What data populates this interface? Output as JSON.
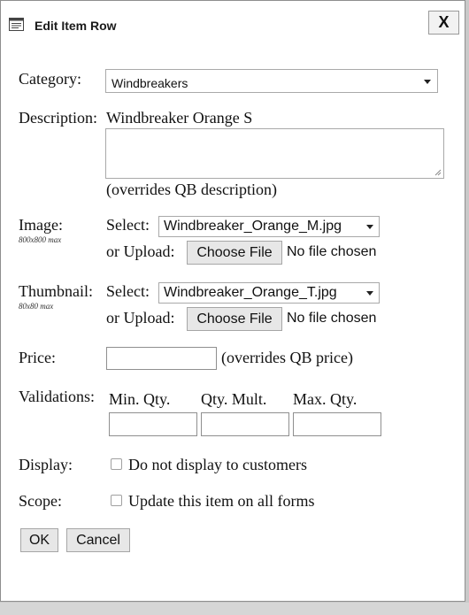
{
  "dialog": {
    "title": "Edit Item Row",
    "close_label": "X"
  },
  "form": {
    "category": {
      "label": "Category:",
      "selected": "Windbreakers"
    },
    "description": {
      "label": "Description:",
      "current_text": "Windbreaker Orange S",
      "value": "",
      "note": "(overrides QB description)"
    },
    "image": {
      "label": "Image:",
      "hint": "800x800 max",
      "select_label": "Select:",
      "selected": "Windbreaker_Orange_M.jpg",
      "upload_label": "or Upload:",
      "choose_file": "Choose File",
      "no_file": "No file chosen"
    },
    "thumbnail": {
      "label": "Thumbnail:",
      "hint": "80x80 max",
      "select_label": "Select:",
      "selected": "Windbreaker_Orange_T.jpg",
      "upload_label": "or Upload:",
      "choose_file": "Choose File",
      "no_file": "No file chosen"
    },
    "price": {
      "label": "Price:",
      "value": "",
      "note": "(overrides QB price)"
    },
    "validations": {
      "label": "Validations:",
      "min_qty": "Min. Qty.",
      "qty_mult": "Qty. Mult.",
      "max_qty": "Max. Qty."
    },
    "display": {
      "label": "Display:",
      "option": "Do not display to customers",
      "checked": false
    },
    "scope": {
      "label": "Scope:",
      "option": "Update this item on all forms",
      "checked": false
    }
  },
  "buttons": {
    "ok": "OK",
    "cancel": "Cancel"
  },
  "icons": {
    "title": "window-form-icon",
    "close": "close-icon",
    "dropdown": "chevron-down-icon",
    "resize": "resize-grip-icon"
  }
}
